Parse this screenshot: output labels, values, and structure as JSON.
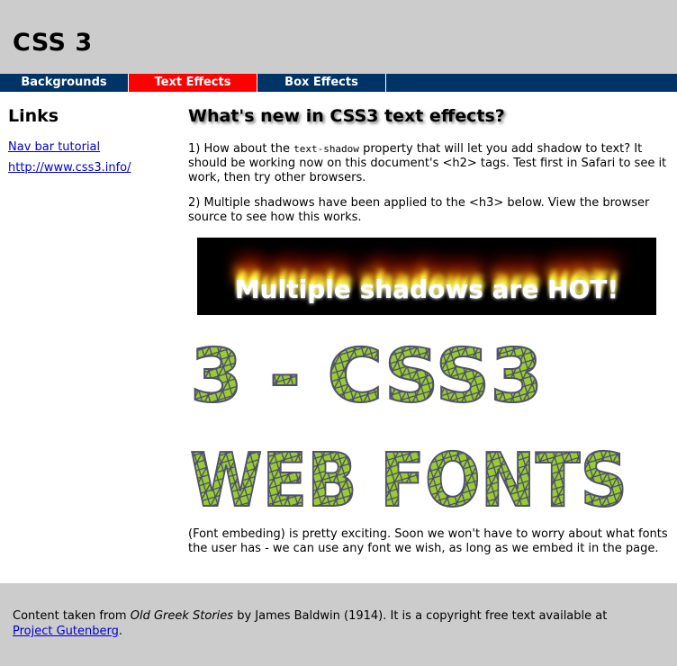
{
  "header": {
    "title": "CSS 3"
  },
  "nav": {
    "tabs": [
      {
        "label": "Backgrounds"
      },
      {
        "label": "Text Effects"
      },
      {
        "label": "Box Effects"
      }
    ]
  },
  "sidebar": {
    "heading": "Links",
    "links": [
      "Nav bar tutorial",
      "http://www.css3.info/"
    ]
  },
  "main": {
    "heading": "What's new in CSS3 text effects?",
    "para1": {
      "before": "1) How about the ",
      "code": "text-shadow",
      "after": " property that will let you add shadow to text? It should be working now on this document's <h2> tags. Test first in Safari to see it work, then try other browsers."
    },
    "para2": "2) Multiple shadwows have been applied to the <h3> below. View the browser source to see how this works.",
    "hot_heading": "Multiple shadows are HOT!",
    "webfont_line1": "3 - CSS3",
    "webfont_line2": "WEB FONTS",
    "para3": "(Font embeding) is pretty exciting. Soon we won't have to worry about what fonts the user has - we can use any font we wish, as long as we embed it in the page."
  },
  "footer": {
    "before": "Content taken from ",
    "book": "Old Greek Stories",
    "middle": " by James Baldwin (1914). It is a copyright free text available at",
    "link": "Project Gutenberg",
    "end": "."
  },
  "colors": {
    "header_bg": "#cccccc",
    "nav_bg": "#003366",
    "nav_active": "#ff0000",
    "link": "#0000cc",
    "webfont_fill": "#99cc33"
  }
}
